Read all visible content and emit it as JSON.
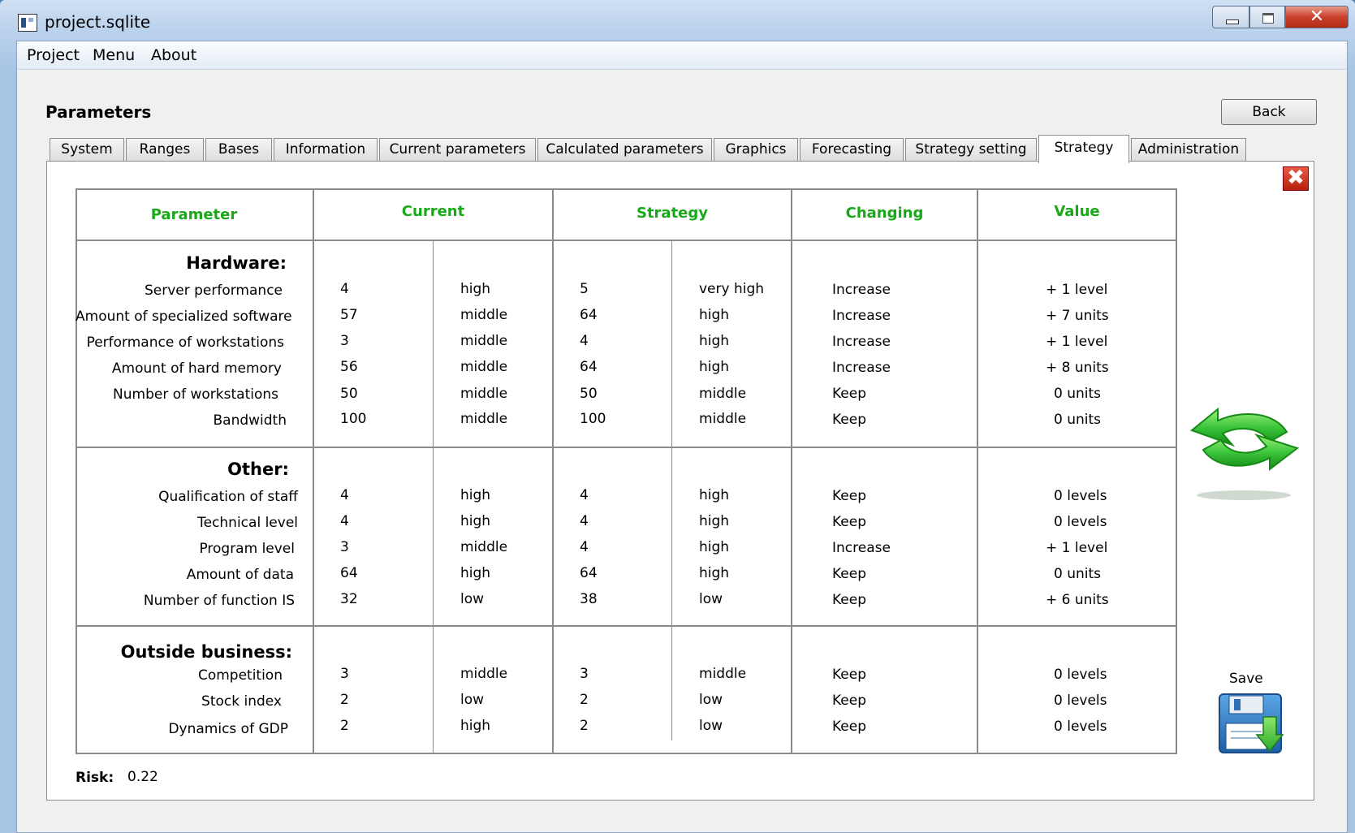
{
  "window": {
    "title": "project.sqlite",
    "close_glyph": "✕"
  },
  "menu": [
    "Project",
    "Menu",
    "About"
  ],
  "page": {
    "heading": "Parameters",
    "back_label": "Back"
  },
  "tabs": [
    {
      "label": "System"
    },
    {
      "label": "Ranges"
    },
    {
      "label": "Bases"
    },
    {
      "label": "Information"
    },
    {
      "label": "Current parameters"
    },
    {
      "label": "Calculated parameters"
    },
    {
      "label": "Graphics"
    },
    {
      "label": "Forecasting"
    },
    {
      "label": "Strategy setting"
    },
    {
      "label": "Strategy",
      "active": true
    },
    {
      "label": "Administration"
    }
  ],
  "panel": {
    "close_glyph": "✖"
  },
  "table": {
    "headers": {
      "parameter": "Parameter",
      "current": "Current",
      "strategy": "Strategy",
      "changing": "Changing",
      "value": "Value"
    },
    "sections": [
      {
        "title": "Hardware:",
        "rows": [
          {
            "name": "Server performance",
            "cur": "4",
            "cur_level": "high",
            "str": "5",
            "str_level": "very high",
            "change": "Increase",
            "value": "+ 1 level"
          },
          {
            "name": "Amount of specialized software",
            "cur": "57",
            "cur_level": "middle",
            "str": "64",
            "str_level": "high",
            "change": "Increase",
            "value": "+ 7 units"
          },
          {
            "name": "Performance of workstations",
            "cur": "3",
            "cur_level": "middle",
            "str": "4",
            "str_level": "high",
            "change": "Increase",
            "value": "+ 1 level"
          },
          {
            "name": "Amount of hard memory",
            "cur": "56",
            "cur_level": "middle",
            "str": "64",
            "str_level": "high",
            "change": "Increase",
            "value": "+ 8 units"
          },
          {
            "name": "Number of workstations",
            "cur": "50",
            "cur_level": "middle",
            "str": "50",
            "str_level": "middle",
            "change": "Keep",
            "value": "0 units"
          },
          {
            "name": "Bandwidth",
            "cur": "100",
            "cur_level": "middle",
            "str": "100",
            "str_level": "middle",
            "change": "Keep",
            "value": "0 units"
          }
        ]
      },
      {
        "title": "Other:",
        "rows": [
          {
            "name": "Qualification of staff",
            "cur": "4",
            "cur_level": "high",
            "str": "4",
            "str_level": "high",
            "change": "Keep",
            "value": "0 levels"
          },
          {
            "name": "Technical level",
            "cur": "4",
            "cur_level": "high",
            "str": "4",
            "str_level": "high",
            "change": "Keep",
            "value": "0 levels"
          },
          {
            "name": "Program level",
            "cur": "3",
            "cur_level": "middle",
            "str": "4",
            "str_level": "high",
            "change": "Increase",
            "value": "+ 1 level"
          },
          {
            "name": "Amount of data",
            "cur": "64",
            "cur_level": "high",
            "str": "64",
            "str_level": "high",
            "change": "Keep",
            "value": "0 units"
          },
          {
            "name": "Number of function IS",
            "cur": "32",
            "cur_level": "low",
            "str": "38",
            "str_level": "low",
            "change": "Keep",
            "value": "+ 6 units"
          }
        ]
      },
      {
        "title": "Outside business:",
        "rows": [
          {
            "name": "Competition",
            "cur": "3",
            "cur_level": "middle",
            "str": "3",
            "str_level": "middle",
            "change": "Keep",
            "value": "0 levels"
          },
          {
            "name": "Stock index",
            "cur": "2",
            "cur_level": "low",
            "str": "2",
            "str_level": "low",
            "change": "Keep",
            "value": "0 levels"
          },
          {
            "name": "Dynamics of GDP",
            "cur": "2",
            "cur_level": "high",
            "str": "2",
            "str_level": "low",
            "change": "Keep",
            "value": "0 levels"
          }
        ]
      }
    ]
  },
  "risk": {
    "label": "Risk:",
    "value": "0.22"
  },
  "actions": {
    "save_label": "Save"
  },
  "colors": {
    "header_green": "#18a818",
    "refresh_green": "#3cc63c",
    "save_blue": "#2f7fc8"
  }
}
